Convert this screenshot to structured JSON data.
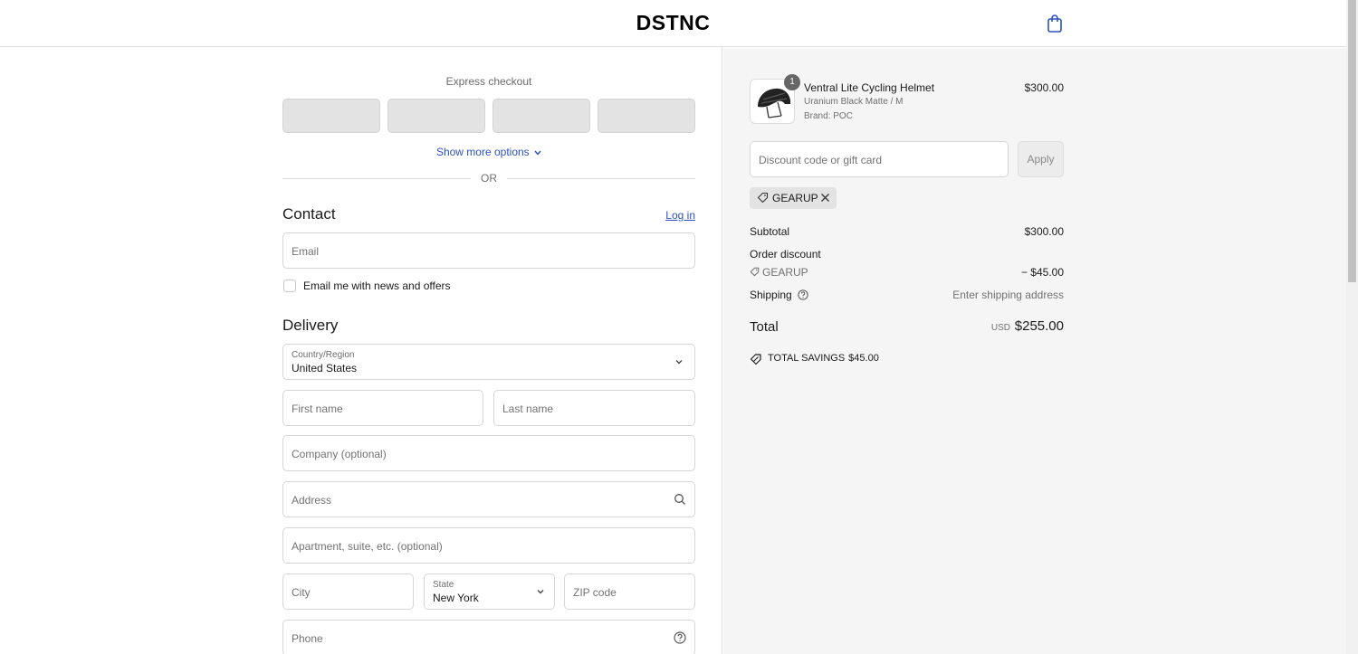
{
  "header": {
    "brand": "DSTNC",
    "cart_icon": "shopping-bag-icon"
  },
  "express": {
    "title": "Express checkout",
    "show_more": "Show more options",
    "or": "OR"
  },
  "contact": {
    "heading": "Contact",
    "login": "Log in",
    "email_placeholder": "Email",
    "newsletter_label": "Email me with news and offers",
    "newsletter_checked": false
  },
  "delivery": {
    "heading": "Delivery",
    "country_label": "Country/Region",
    "country_value": "United States",
    "first_name_placeholder": "First name",
    "last_name_placeholder": "Last name",
    "company_placeholder": "Company (optional)",
    "address_placeholder": "Address",
    "apartment_placeholder": "Apartment, suite, etc. (optional)",
    "city_placeholder": "City",
    "state_label": "State",
    "state_value": "New York",
    "zip_placeholder": "ZIP code",
    "phone_placeholder": "Phone"
  },
  "order": {
    "item": {
      "quantity": "1",
      "name": "Ventral Lite Cycling Helmet",
      "variant": "Uranium Black Matte / M",
      "brand": "Brand: POC",
      "price": "$300.00"
    },
    "discount_placeholder": "Discount code or gift card",
    "apply_label": "Apply",
    "applied_code": "GEARUP",
    "subtotal_label": "Subtotal",
    "subtotal_value": "$300.00",
    "order_discount_label": "Order discount",
    "discount_code": "GEARUP",
    "discount_value": "− $45.00",
    "shipping_label": "Shipping",
    "shipping_value": "Enter shipping address",
    "total_label": "Total",
    "total_currency": "USD",
    "total_value": "$255.00",
    "savings_label": "TOTAL SAVINGS",
    "savings_value": "$45.00"
  },
  "colors": {
    "link": "#2d50c4",
    "sidebar_bg": "#f5f5f5",
    "border": "#dedede"
  }
}
